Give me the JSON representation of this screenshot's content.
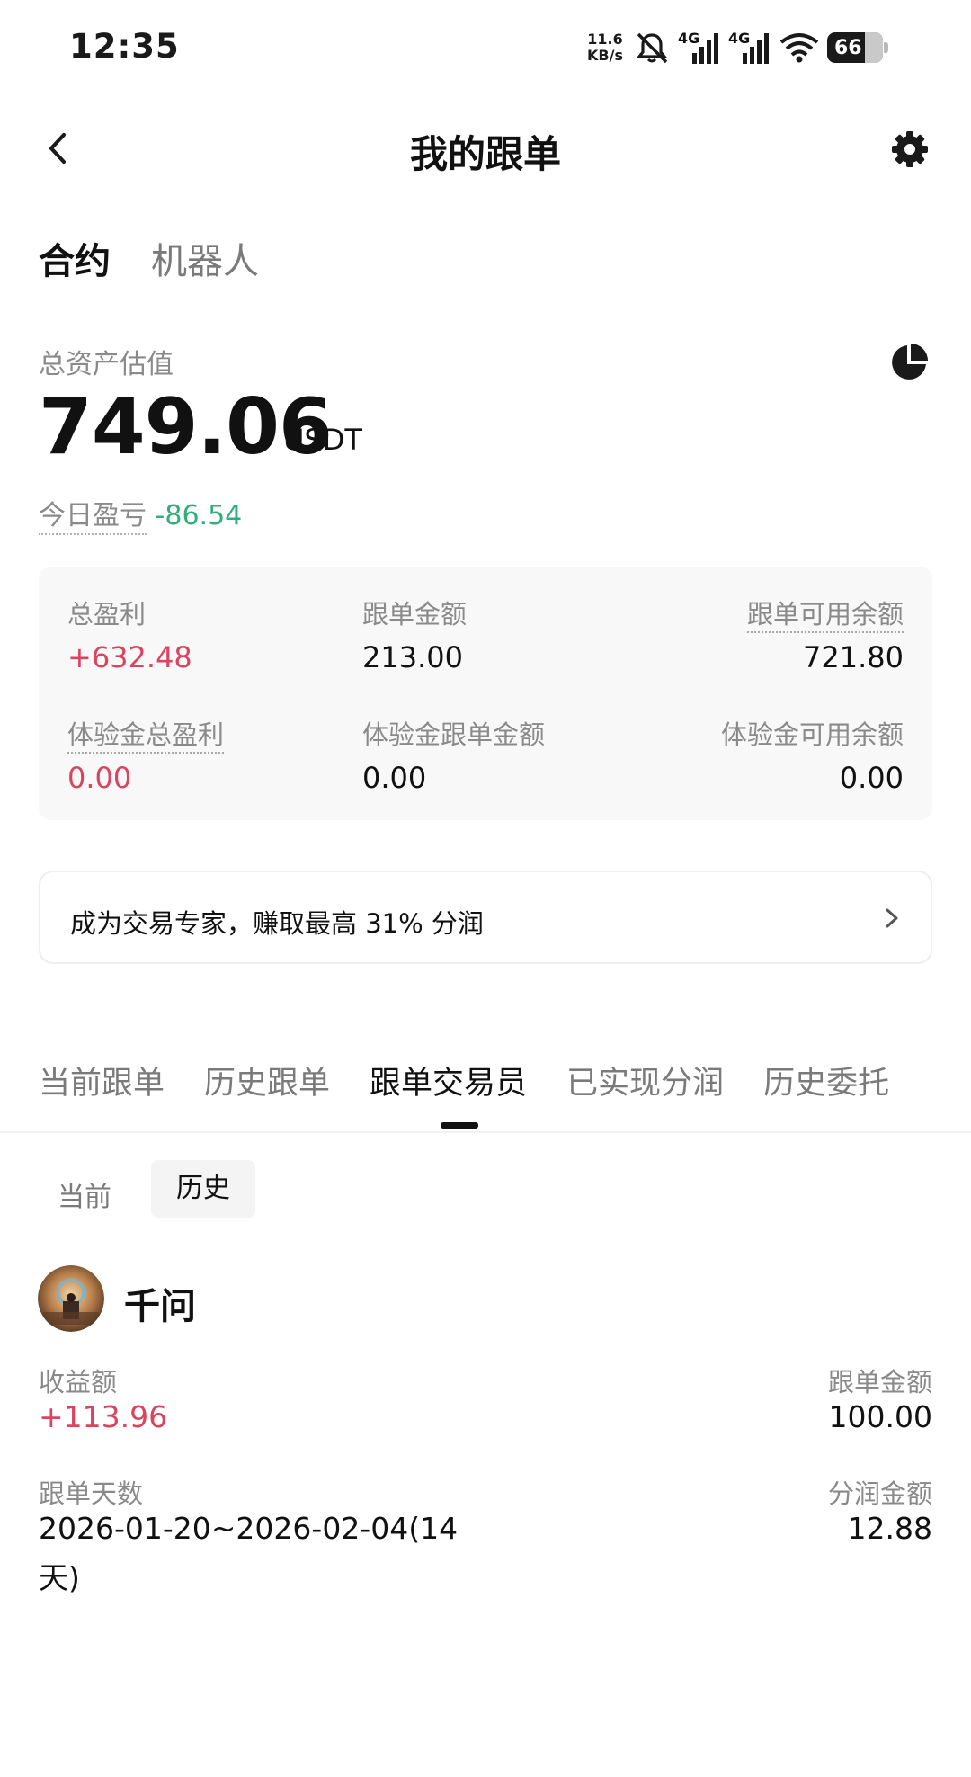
{
  "status_bar": {
    "time": "12:35",
    "net_speed_value": "11.6",
    "net_speed_unit": "KB/s",
    "signal1_label": "4G",
    "signal2_label": "4G",
    "battery": "66"
  },
  "nav": {
    "title": "我的跟单"
  },
  "main_tabs": {
    "contract": "合约",
    "robot": "机器人"
  },
  "assets": {
    "label": "总资产估值",
    "value": "749.06",
    "unit": "USDT",
    "today_label": "今日盈亏",
    "today_value": "-86.54"
  },
  "stats": {
    "total_profit_label": "总盈利",
    "total_profit_value": "+632.48",
    "copy_amount_label": "跟单金额",
    "copy_amount_value": "213.00",
    "available_label": "跟单可用余额",
    "available_value": "721.80",
    "trial_profit_label": "体验金总盈利",
    "trial_profit_value": "0.00",
    "trial_copy_label": "体验金跟单金额",
    "trial_copy_value": "0.00",
    "trial_available_label": "体验金可用余额",
    "trial_available_value": "0.00"
  },
  "banner": {
    "text": "成为交易专家，赚取最高 31% 分润"
  },
  "sub_tabs": [
    "当前跟单",
    "历史跟单",
    "跟单交易员",
    "已实现分润",
    "历史委托"
  ],
  "active_sub_tab": "跟单交易员",
  "segment": {
    "current": "当前",
    "history": "历史",
    "active": "历史"
  },
  "trader": {
    "name": "千问",
    "earnings_label": "收益额",
    "earnings_value": "+113.96",
    "copy_amount_label": "跟单金额",
    "copy_amount_value": "100.00",
    "days_label": "跟单天数",
    "days_value_line1": "2026-01-20~2026-02-04(14",
    "days_value_line2": "天)",
    "profit_share_label": "分润金额",
    "profit_share_value": "12.88"
  },
  "colors": {
    "profit_red": "#d9455f",
    "loss_green": "#2fae7a",
    "muted_text": "#8a8a8a"
  }
}
